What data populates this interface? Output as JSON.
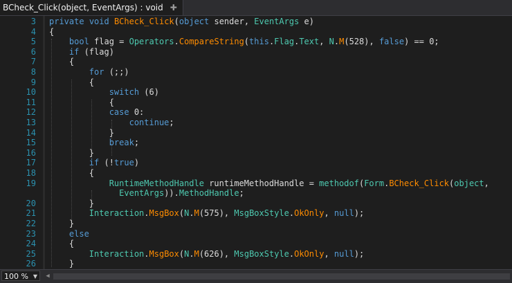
{
  "tab": {
    "title": "BCheck_Click(object, EventArgs) : void",
    "close": "✚"
  },
  "status": {
    "zoom": "100 %",
    "scroll_left": "◀"
  },
  "lines": [
    {
      "n": "3",
      "tokens": [
        {
          "c": "kw",
          "t": "private"
        },
        {
          "c": "pu",
          "t": " "
        },
        {
          "c": "kw",
          "t": "void"
        },
        {
          "c": "pu",
          "t": " "
        },
        {
          "c": "me",
          "t": "BCheck_Click"
        },
        {
          "c": "pu",
          "t": "("
        },
        {
          "c": "kw",
          "t": "object"
        },
        {
          "c": "pu",
          "t": " sender, "
        },
        {
          "c": "ty",
          "t": "EventArgs"
        },
        {
          "c": "pu",
          "t": " e)"
        }
      ]
    },
    {
      "n": "4",
      "tokens": [
        {
          "c": "pu",
          "t": "{"
        }
      ]
    },
    {
      "n": "5",
      "tokens": [
        {
          "c": "pu",
          "t": "    "
        },
        {
          "c": "kw",
          "t": "bool"
        },
        {
          "c": "pu",
          "t": " flag = "
        },
        {
          "c": "ty",
          "t": "Operators"
        },
        {
          "c": "pu",
          "t": "."
        },
        {
          "c": "me",
          "t": "CompareString"
        },
        {
          "c": "pu",
          "t": "("
        },
        {
          "c": "kw",
          "t": "this"
        },
        {
          "c": "pu",
          "t": "."
        },
        {
          "c": "ty",
          "t": "Flag"
        },
        {
          "c": "pu",
          "t": "."
        },
        {
          "c": "ty",
          "t": "Text"
        },
        {
          "c": "pu",
          "t": ", "
        },
        {
          "c": "ty",
          "t": "N"
        },
        {
          "c": "pu",
          "t": "."
        },
        {
          "c": "me",
          "t": "M"
        },
        {
          "c": "pu",
          "t": "(528), "
        },
        {
          "c": "kw",
          "t": "false"
        },
        {
          "c": "pu",
          "t": ") == 0;"
        }
      ]
    },
    {
      "n": "6",
      "tokens": [
        {
          "c": "pu",
          "t": "    "
        },
        {
          "c": "kw",
          "t": "if"
        },
        {
          "c": "pu",
          "t": " (flag)"
        }
      ]
    },
    {
      "n": "7",
      "tokens": [
        {
          "c": "pu",
          "t": "    {"
        }
      ]
    },
    {
      "n": "8",
      "tokens": [
        {
          "c": "pu",
          "t": "        "
        },
        {
          "c": "kw",
          "t": "for"
        },
        {
          "c": "pu",
          "t": " (;;)"
        }
      ]
    },
    {
      "n": "9",
      "tokens": [
        {
          "c": "pu",
          "t": "        {"
        }
      ]
    },
    {
      "n": "10",
      "tokens": [
        {
          "c": "pu",
          "t": "            "
        },
        {
          "c": "kw",
          "t": "switch"
        },
        {
          "c": "pu",
          "t": " (6)"
        }
      ]
    },
    {
      "n": "11",
      "tokens": [
        {
          "c": "pu",
          "t": "            {"
        }
      ]
    },
    {
      "n": "12",
      "tokens": [
        {
          "c": "pu",
          "t": "            "
        },
        {
          "c": "kw",
          "t": "case"
        },
        {
          "c": "pu",
          "t": " 0:"
        }
      ]
    },
    {
      "n": "13",
      "tokens": [
        {
          "c": "pu",
          "t": "                "
        },
        {
          "c": "kw",
          "t": "continue"
        },
        {
          "c": "pu",
          "t": ";"
        }
      ]
    },
    {
      "n": "14",
      "tokens": [
        {
          "c": "pu",
          "t": "            }"
        }
      ]
    },
    {
      "n": "15",
      "tokens": [
        {
          "c": "pu",
          "t": "            "
        },
        {
          "c": "kw",
          "t": "break"
        },
        {
          "c": "pu",
          "t": ";"
        }
      ]
    },
    {
      "n": "16",
      "tokens": [
        {
          "c": "pu",
          "t": "        }"
        }
      ]
    },
    {
      "n": "17",
      "tokens": [
        {
          "c": "pu",
          "t": "        "
        },
        {
          "c": "kw",
          "t": "if"
        },
        {
          "c": "pu",
          "t": " (!"
        },
        {
          "c": "kw",
          "t": "true"
        },
        {
          "c": "pu",
          "t": ")"
        }
      ]
    },
    {
      "n": "18",
      "tokens": [
        {
          "c": "pu",
          "t": "        {"
        }
      ]
    },
    {
      "n": "19",
      "tokens": [
        {
          "c": "pu",
          "t": "            "
        },
        {
          "c": "ty",
          "t": "RuntimeMethodHandle"
        },
        {
          "c": "pu",
          "t": " runtimeMethodHandle = "
        },
        {
          "c": "ty",
          "t": "methodof"
        },
        {
          "c": "pu",
          "t": "("
        },
        {
          "c": "ty",
          "t": "Form"
        },
        {
          "c": "pu",
          "t": "."
        },
        {
          "c": "me",
          "t": "BCheck_Click"
        },
        {
          "c": "pu",
          "t": "("
        },
        {
          "c": "ty",
          "t": "object"
        },
        {
          "c": "pu",
          "t": ","
        }
      ]
    },
    {
      "n": "",
      "tokens": [
        {
          "c": "pu",
          "t": "              "
        },
        {
          "c": "ty",
          "t": "EventArgs"
        },
        {
          "c": "pu",
          "t": "))."
        },
        {
          "c": "ty",
          "t": "MethodHandle"
        },
        {
          "c": "pu",
          "t": ";"
        }
      ]
    },
    {
      "n": "20",
      "tokens": [
        {
          "c": "pu",
          "t": "        }"
        }
      ]
    },
    {
      "n": "21",
      "tokens": [
        {
          "c": "pu",
          "t": "        "
        },
        {
          "c": "ty",
          "t": "Interaction"
        },
        {
          "c": "pu",
          "t": "."
        },
        {
          "c": "me",
          "t": "MsgBox"
        },
        {
          "c": "pu",
          "t": "("
        },
        {
          "c": "ty",
          "t": "N"
        },
        {
          "c": "pu",
          "t": "."
        },
        {
          "c": "me",
          "t": "M"
        },
        {
          "c": "pu",
          "t": "(575), "
        },
        {
          "c": "ty",
          "t": "MsgBoxStyle"
        },
        {
          "c": "pu",
          "t": "."
        },
        {
          "c": "me",
          "t": "OkOnly"
        },
        {
          "c": "pu",
          "t": ", "
        },
        {
          "c": "kw",
          "t": "null"
        },
        {
          "c": "pu",
          "t": ");"
        }
      ]
    },
    {
      "n": "22",
      "tokens": [
        {
          "c": "pu",
          "t": "    }"
        }
      ]
    },
    {
      "n": "23",
      "tokens": [
        {
          "c": "pu",
          "t": "    "
        },
        {
          "c": "kw",
          "t": "else"
        }
      ]
    },
    {
      "n": "24",
      "tokens": [
        {
          "c": "pu",
          "t": "    {"
        }
      ]
    },
    {
      "n": "25",
      "tokens": [
        {
          "c": "pu",
          "t": "        "
        },
        {
          "c": "ty",
          "t": "Interaction"
        },
        {
          "c": "pu",
          "t": "."
        },
        {
          "c": "me",
          "t": "MsgBox"
        },
        {
          "c": "pu",
          "t": "("
        },
        {
          "c": "ty",
          "t": "N"
        },
        {
          "c": "pu",
          "t": "."
        },
        {
          "c": "me",
          "t": "M"
        },
        {
          "c": "pu",
          "t": "(626), "
        },
        {
          "c": "ty",
          "t": "MsgBoxStyle"
        },
        {
          "c": "pu",
          "t": "."
        },
        {
          "c": "me",
          "t": "OkOnly"
        },
        {
          "c": "pu",
          "t": ", "
        },
        {
          "c": "kw",
          "t": "null"
        },
        {
          "c": "pu",
          "t": ");"
        }
      ]
    },
    {
      "n": "26",
      "tokens": [
        {
          "c": "pu",
          "t": "    }"
        }
      ]
    }
  ]
}
